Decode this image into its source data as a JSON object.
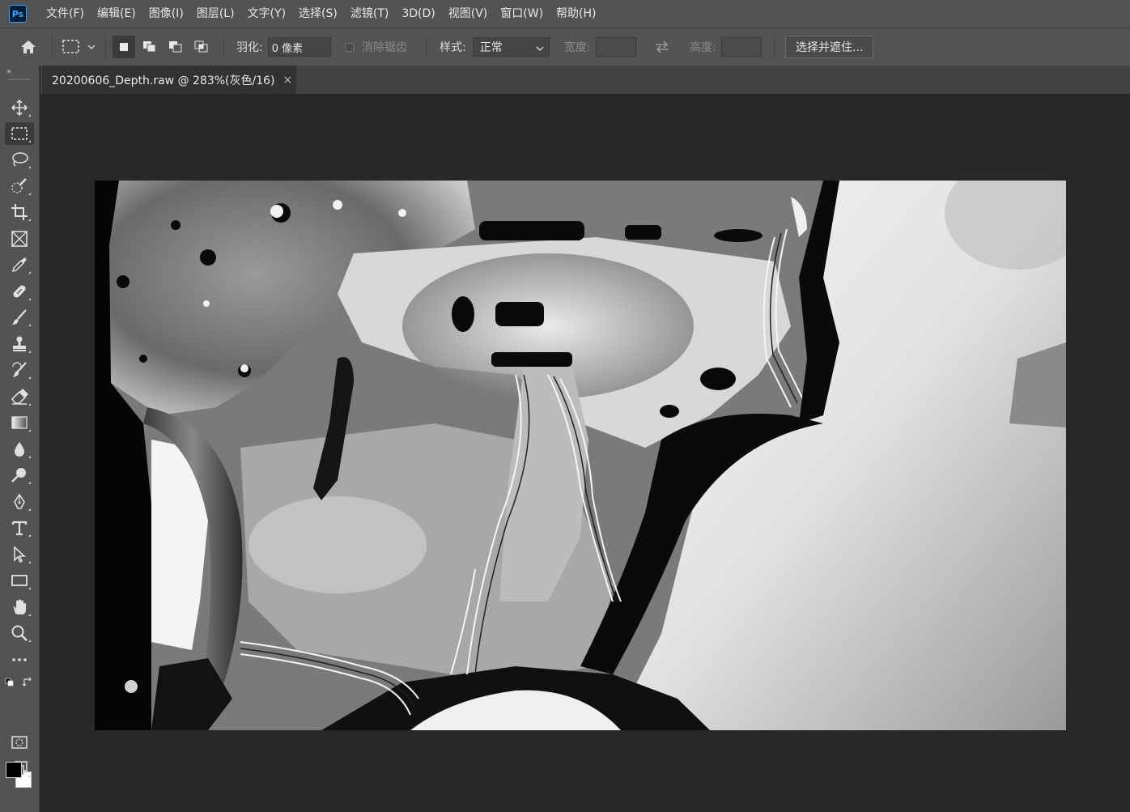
{
  "app": {
    "logo_text": "Ps",
    "menus": [
      "文件(F)",
      "编辑(E)",
      "图像(I)",
      "图层(L)",
      "文字(Y)",
      "选择(S)",
      "滤镜(T)",
      "3D(D)",
      "视图(V)",
      "窗口(W)",
      "帮助(H)"
    ]
  },
  "options": {
    "feather_label": "羽化:",
    "feather_value": "0 像素",
    "antialias_label": "消除锯齿",
    "style_label": "样式:",
    "style_value": "正常",
    "width_label": "宽度:",
    "height_label": "高度:",
    "select_mask_button": "选择并遮住..."
  },
  "document": {
    "tab_title": "20200606_Depth.raw  @  283%(灰色/16)",
    "close_glyph": "×"
  },
  "tools": [
    "move-tool",
    "rectangular-marquee-tool",
    "lasso-tool",
    "quick-selection-tool",
    "crop-tool",
    "frame-tool",
    "eyedropper-tool",
    "spot-healing-brush-tool",
    "brush-tool",
    "clone-stamp-tool",
    "history-brush-tool",
    "eraser-tool",
    "gradient-tool",
    "blur-tool",
    "dodge-tool",
    "pen-tool",
    "type-tool",
    "path-selection-tool",
    "rectangle-tool",
    "hand-tool",
    "zoom-tool",
    "edit-toolbar",
    "quick-mask-mode",
    "screen-mode"
  ],
  "colors": {
    "foreground": "#000000",
    "background": "#ffffff",
    "ui_panel": "#535353",
    "workspace": "#282828"
  }
}
